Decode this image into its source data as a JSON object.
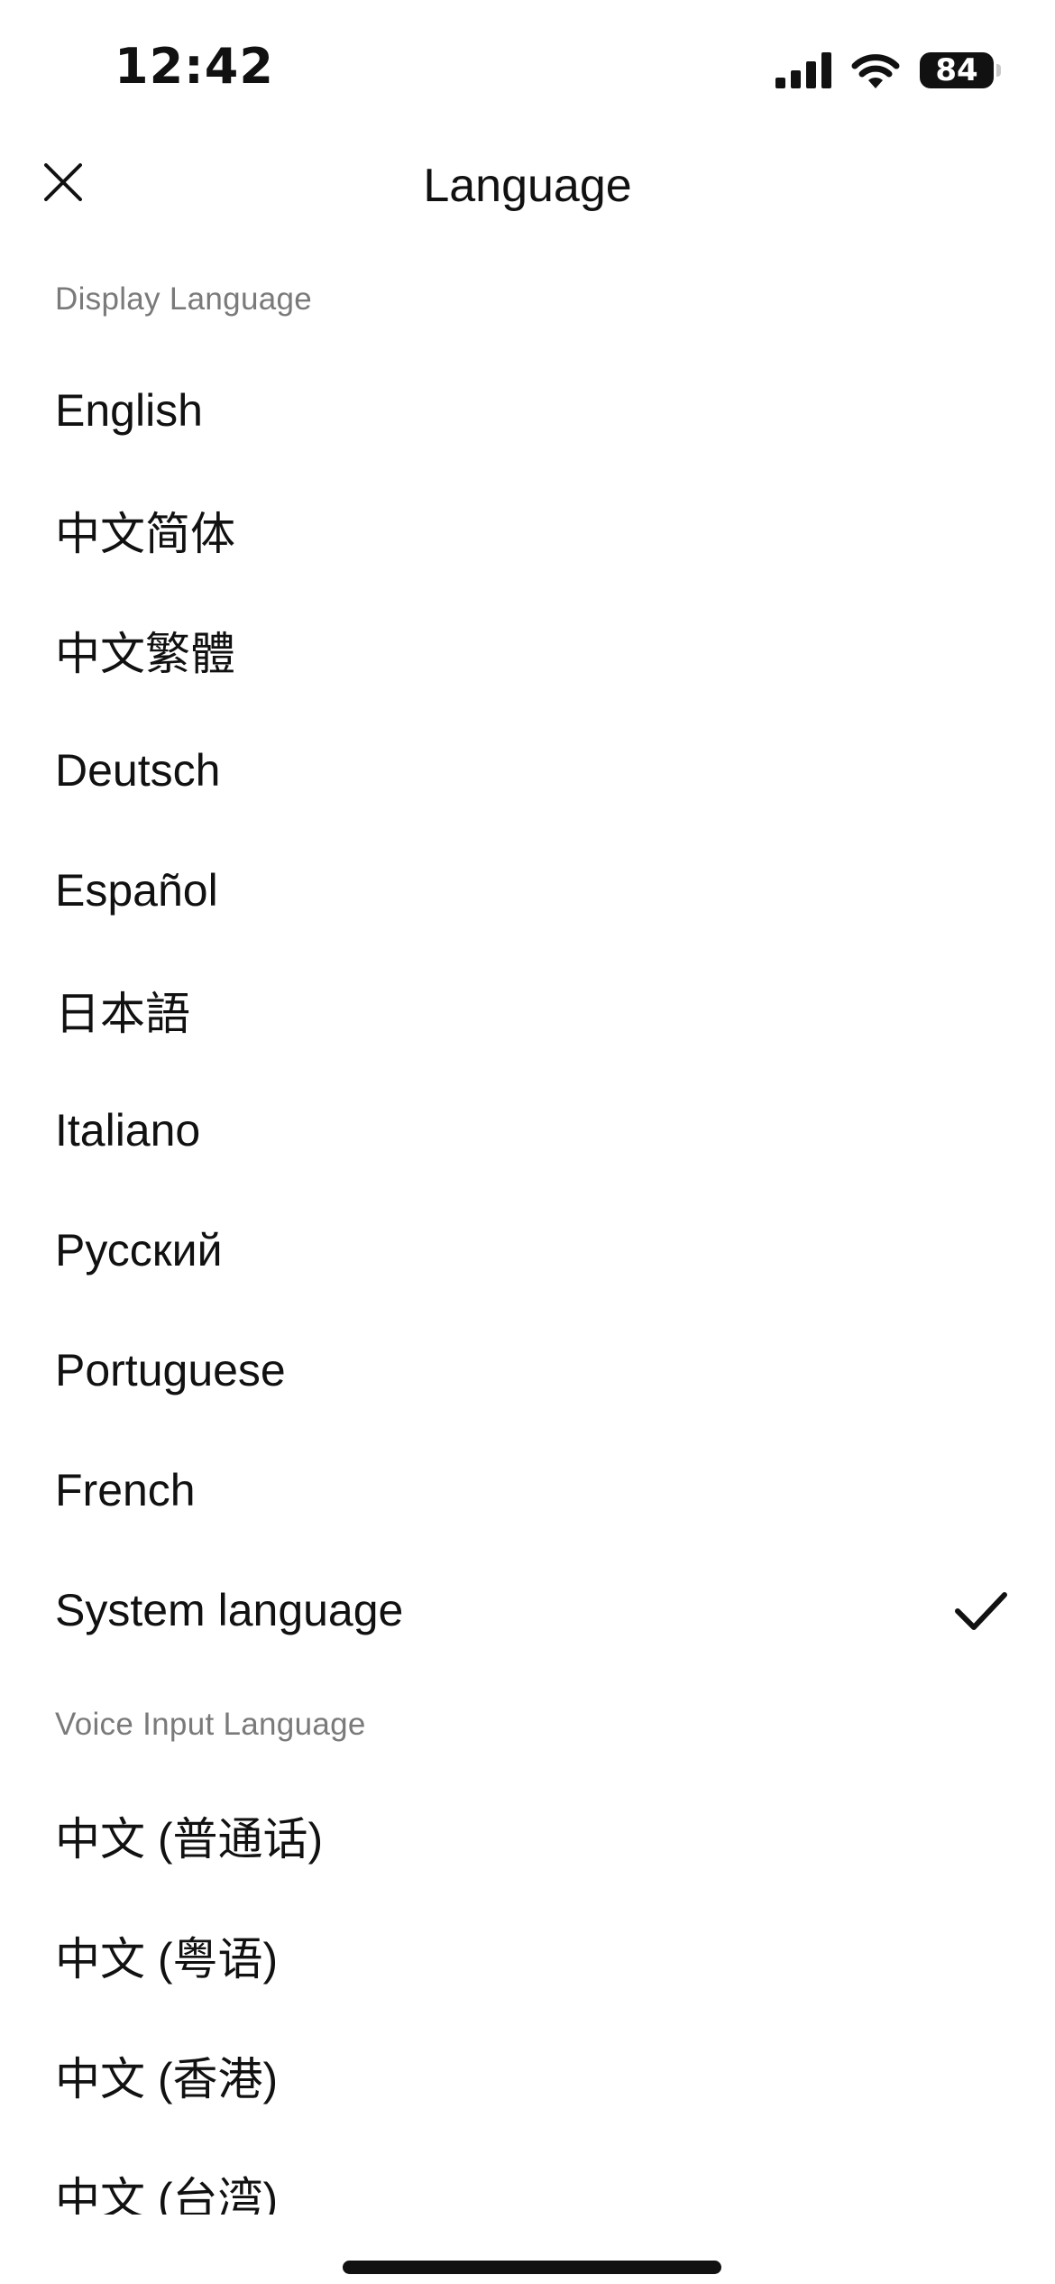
{
  "status_bar": {
    "time": "12:42",
    "battery": "84",
    "icons": [
      "cellular-signal-icon",
      "wifi-icon",
      "battery-icon"
    ]
  },
  "header": {
    "title": "Language",
    "close_icon": "close-icon"
  },
  "sections": {
    "display": {
      "title": "Display Language",
      "items": [
        {
          "label": "English"
        },
        {
          "label": "中文简体"
        },
        {
          "label": "中文繁體"
        },
        {
          "label": "Deutsch"
        },
        {
          "label": "Español"
        },
        {
          "label": "日本語"
        },
        {
          "label": "Italiano"
        },
        {
          "label": "Русский"
        },
        {
          "label": "Portuguese"
        },
        {
          "label": "French"
        },
        {
          "label": "System language",
          "selected": true
        }
      ]
    },
    "voice": {
      "title": "Voice Input Language",
      "items": [
        {
          "label": "中文 (普通话)"
        },
        {
          "label": "中文 (粤语)"
        },
        {
          "label": "中文 (香港)"
        },
        {
          "label": "中文 (台湾)"
        }
      ]
    }
  },
  "colors": {
    "background": "#ffffff",
    "text": "#111111",
    "section_header": "#7a7a7a"
  }
}
